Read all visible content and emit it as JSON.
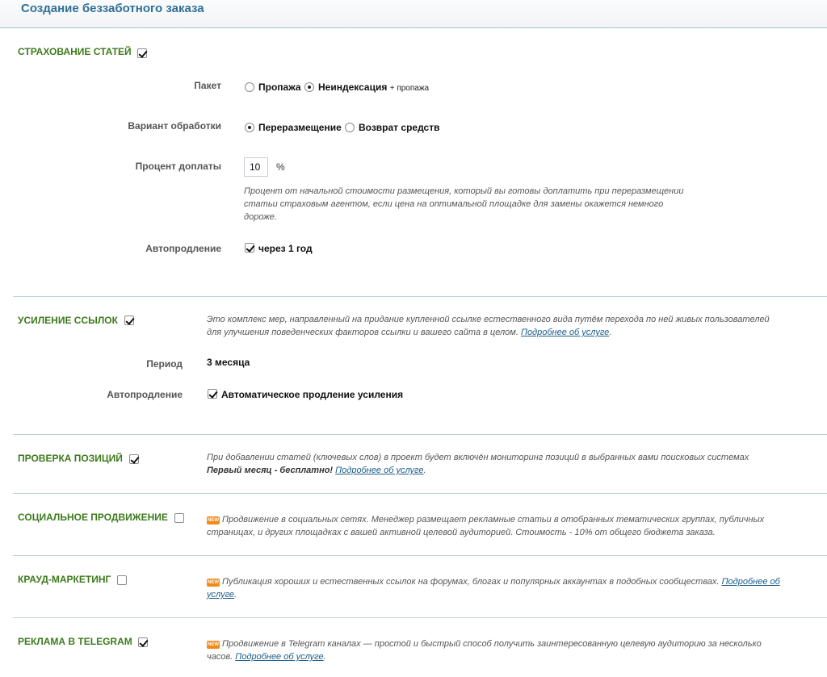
{
  "page": {
    "title": "Создание беззаботного заказа"
  },
  "insurance": {
    "title": "СТРАХОВАНИЕ СТАТЕЙ",
    "enabled": true,
    "package_label": "Пакет",
    "package_options": [
      "Пропажа",
      "Неиндексация"
    ],
    "package_selected": "Неиндексация",
    "package_suffix": "+ пропажа",
    "processing_label": "Вариант обработки",
    "processing_options": [
      "Переразмещение",
      "Возврат средств"
    ],
    "processing_selected": "Переразмещение",
    "surcharge_label": "Процент доплаты",
    "surcharge_value": "10",
    "surcharge_unit": "%",
    "surcharge_hint": "Процент от начальной стоимости размещения, который вы готовы доплатить при переразмещении статьи страховым агентом, если цена на оптимальной площадке для замены окажется немного дороже.",
    "autorenew_label": "Автопродление",
    "autorenew_checked": true,
    "autorenew_text": "через 1 год"
  },
  "links": {
    "title": "УСИЛЕНИЕ ССЫЛОК",
    "enabled": true,
    "description": "Это комплекс мер, направленный на придание купленной ссылке естественного вида путём перехода по ней живых пользователей для улучшения поведенческих факторов ссылки и вашего сайта в целом.",
    "more_link": "Подробнее об услуге",
    "period_label": "Период",
    "period_value": "3 месяца",
    "autorenew_label": "Автопродление",
    "autorenew_checked": true,
    "autorenew_text": "Автоматическое продление усиления"
  },
  "positions": {
    "title": "ПРОВЕРКА ПОЗИЦИЙ",
    "enabled": true,
    "description": "При добавлении статей (ключевых слов) в проект будет включён мониторинг позиций в выбранных вами поисковых системах",
    "bold_text": "Первый месяц - бесплатно!",
    "more_link": "Подробнее об услуге"
  },
  "social": {
    "title": "СОЦИАЛЬНОЕ ПРОДВИЖЕНИЕ",
    "enabled": false,
    "badge": "NEW",
    "description": "Продвижение в социальных сетях. Менеджер размещает рекламные статьи в отобранных тематических группах, публичных страницах, и других площадках с вашей активной целевой аудиторией. Стоимость - 10% от общего бюджета заказа."
  },
  "crowd": {
    "title": "КРАУД-МАРКЕТИНГ",
    "enabled": false,
    "badge": "NEW",
    "description": "Публикация хороших и естественных ссылок на форумах, блогах и популярных аккаунтах в подобных сообществах.",
    "more_link": "Подробнее об услуге"
  },
  "telegram": {
    "title": "РЕКЛАМА В TELEGRAM",
    "enabled": true,
    "badge": "NEW",
    "description": "Продвижение в Telegram каналах — простой и быстрый способ получить заинтересованную целевую аудиторию за несколько часов.",
    "more_link": "Подробнее об услуге"
  },
  "colors": {
    "section_title": "#3d7a1c",
    "page_title": "#2f6f95",
    "link": "#1a5c8a",
    "divider": "#bcd3e0",
    "badge": "#f08a18"
  }
}
